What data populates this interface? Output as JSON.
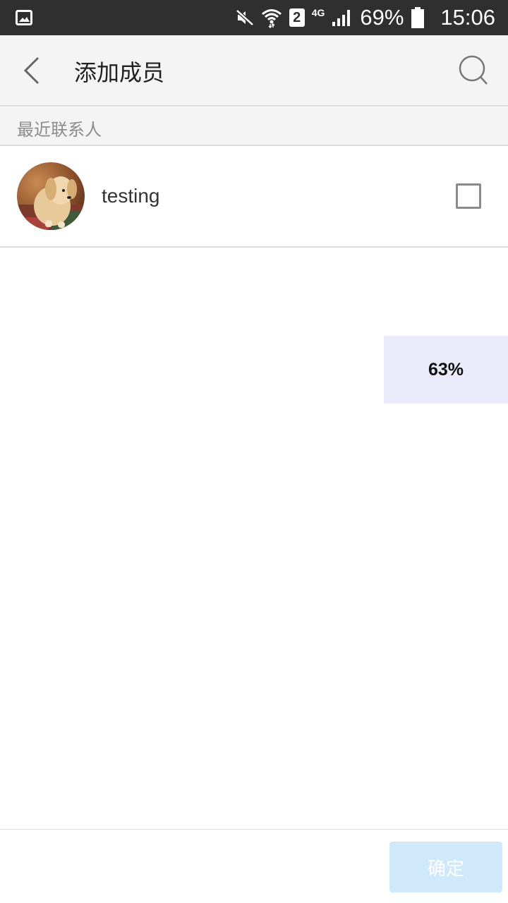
{
  "status_bar": {
    "icons": [
      "gallery-icon",
      "mute-icon",
      "wifi-icon",
      "sim-icon",
      "network-icon",
      "signal-icon",
      "battery-icon"
    ],
    "sim_label": "2",
    "network_label": "4G",
    "battery": "69%",
    "time": "15:06"
  },
  "header": {
    "title": "添加成员",
    "back_icon": "chevron-left-icon",
    "search_icon": "search-icon"
  },
  "section": {
    "label": "最近联系人"
  },
  "contacts": [
    {
      "name": "testing",
      "avatar": "dog-photo",
      "checked": false
    }
  ],
  "progress": {
    "label": "63%"
  },
  "footer": {
    "confirm_label": "确定"
  },
  "colors": {
    "status_bar_bg": "#2f2f2f",
    "header_bg": "#f4f4f4",
    "confirm_bg_disabled": "#cfe8fc",
    "progress_bg": "#ecebfb"
  }
}
